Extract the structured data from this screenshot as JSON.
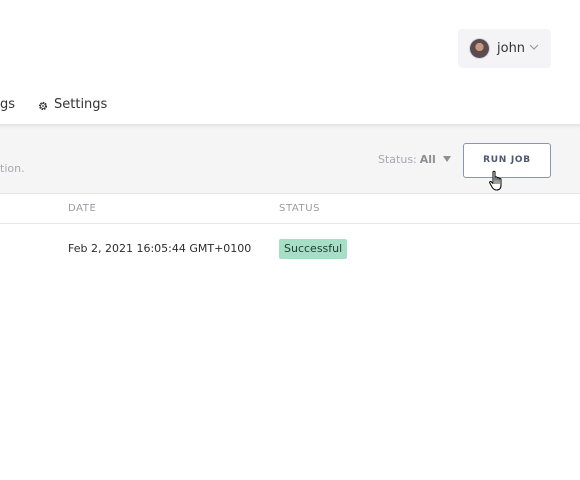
{
  "user_menu": {
    "username": "john",
    "avatar_icon": "user-avatar",
    "chevron_icon": "chevron-down-icon"
  },
  "nav": {
    "partial_tab_fragment": "gs",
    "settings_tab": {
      "label": "Settings",
      "icon": "gear-icon"
    }
  },
  "toolbar": {
    "description_fragment": "tion.",
    "status_filter": {
      "label": "Status:",
      "value": "All"
    },
    "run_job_label": "RUN JOB"
  },
  "table": {
    "columns": [
      "DATE",
      "STATUS"
    ],
    "rows": [
      {
        "date": "Feb 2, 2021 16:05:44 GMT+0100",
        "status": "Successful"
      }
    ]
  },
  "colors": {
    "toolbar_bg": "#f5f5f6",
    "button_border": "#8d94b0",
    "success_badge": "#a7dfc6"
  }
}
